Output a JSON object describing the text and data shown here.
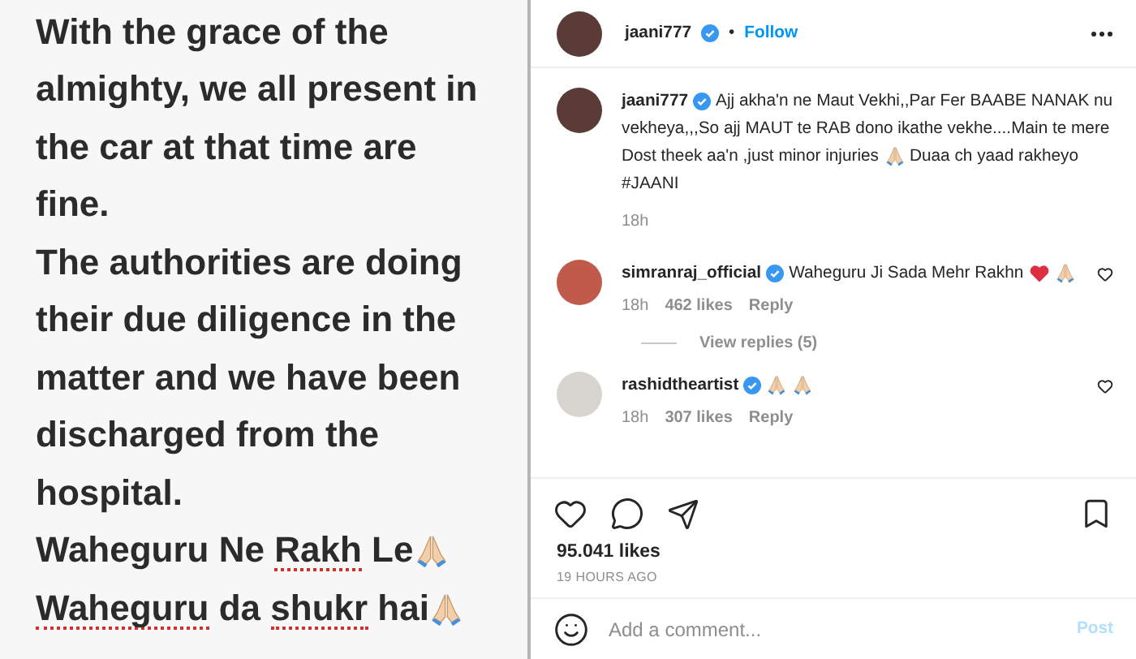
{
  "note_image": {
    "lines": [
      [
        {
          "text": "With the grace of the",
          "misspelled": false
        }
      ],
      [
        {
          "text": "almighty, we all present in",
          "misspelled": false
        }
      ],
      [
        {
          "text": "the car at that time are",
          "misspelled": false
        }
      ],
      [
        {
          "text": "fine.",
          "misspelled": false
        }
      ],
      [
        {
          "text": "The authorities are doing",
          "misspelled": false
        }
      ],
      [
        {
          "text": "their due diligence in the",
          "misspelled": false
        }
      ],
      [
        {
          "text": "matter and we have been",
          "misspelled": false
        }
      ],
      [
        {
          "text": "discharged from the",
          "misspelled": false
        }
      ],
      [
        {
          "text": "hospital.",
          "misspelled": false
        }
      ],
      [
        {
          "text": "Waheguru Ne ",
          "misspelled": false
        },
        {
          "text": "Rakh",
          "misspelled": true
        },
        {
          "text": " Le",
          "misspelled": false
        },
        {
          "kind": "pray"
        }
      ],
      [
        {
          "text": "Waheguru",
          "misspelled": true
        },
        {
          "text": " da ",
          "misspelled": false
        },
        {
          "text": "shukr",
          "misspelled": true
        },
        {
          "text": " hai",
          "misspelled": false
        },
        {
          "kind": "pray"
        }
      ]
    ]
  },
  "header": {
    "username": "jaani777",
    "verified": true,
    "separator": "•",
    "follow": "Follow"
  },
  "caption": {
    "username": "jaani777",
    "verified": true,
    "lines": [
      [
        {
          "text": "Ajj akha'n ne Maut Vekhi,,Par Fer BAABE NANAK nu"
        }
      ],
      [
        {
          "text": "vekheya,,,So ajj MAUT te RAB dono ikathe vekhe....Main te mere"
        }
      ],
      [
        {
          "text": "Dost theek aa'n ,just minor injuries"
        },
        {
          "kind": "pray"
        },
        {
          "text": "Duaa ch yaad rakheyo"
        }
      ],
      [
        {
          "text": "#JAANI"
        }
      ]
    ],
    "time": "18h"
  },
  "comments": [
    {
      "username": "simranraj_official",
      "verified": true,
      "lines": [
        [
          {
            "text": "Waheguru Ji Sada Mehr Rakhn"
          },
          {
            "kind": "heart"
          },
          {
            "kind": "pray"
          }
        ]
      ],
      "time": "18h",
      "likes": "462 likes",
      "reply": "Reply",
      "view_replies": "View replies (5)",
      "liked": false
    },
    {
      "username": "rashidtheartist",
      "verified": true,
      "lines": [
        [
          {
            "kind": "pray"
          },
          {
            "kind": "pray"
          }
        ]
      ],
      "time": "18h",
      "likes": "307 likes",
      "reply": "Reply",
      "liked": false
    }
  ],
  "actions": {
    "liked": false,
    "saved": false
  },
  "likes": "95.041 likes",
  "posted": "19 HOURS AGO",
  "comment_box": {
    "placeholder": "Add a comment...",
    "post": "Post"
  }
}
